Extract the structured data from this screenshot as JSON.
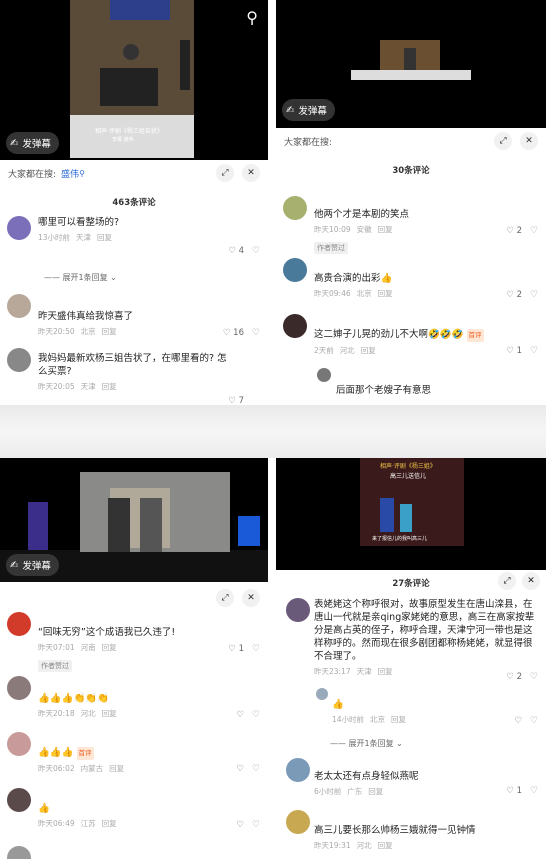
{
  "p1": {
    "danmu": "发弹幕",
    "search_label": "大家都在搜:",
    "search_kw": "盛伟",
    "count": "463条评论",
    "video_caption": "相声·评剧《杨三姐告状》",
    "video_caption2": "李菁 盛伟",
    "comments": [
      {
        "text": "哪里可以看整场的?",
        "time": "13小时前",
        "loc": "天津",
        "reply": "回复",
        "likes": "4",
        "expand": "展开1条回复"
      },
      {
        "text": "昨天盛伟真给我惊喜了",
        "time": "昨天20:50",
        "loc": "北京",
        "reply": "回复",
        "likes": "16"
      },
      {
        "text": "我妈妈最新欢杨三姐告状了，在哪里看的? 怎么买票?",
        "time": "昨天20:05",
        "loc": "天津",
        "reply": "回复",
        "likes": "7"
      }
    ]
  },
  "p2": {
    "danmu": "发弹幕",
    "search_label": "大家都在搜:",
    "count": "30条评论",
    "comments": [
      {
        "text": "他两个才是本剧的笑点",
        "time": "昨天10:09",
        "loc": "安徽",
        "reply": "回复",
        "likes": "2",
        "tag": "作者赞过"
      },
      {
        "text": "高贵合演的出彩👍",
        "time": "昨天09:46",
        "loc": "北京",
        "reply": "回复",
        "likes": "2"
      },
      {
        "text": "这二婶子儿晃的劲儿不大啊🤣🤣🤣",
        "time": "2天前",
        "loc": "河北",
        "reply": "回复",
        "likes": "1",
        "badge": "首评"
      },
      {
        "text": "后面那个老嫂子有意思"
      }
    ]
  },
  "p3": {
    "danmu": "发弹幕",
    "count": "",
    "comments": [
      {
        "text": "“回味无穷”这个成语我已久违了!",
        "time": "昨天07:01",
        "loc": "河南",
        "reply": "回复",
        "likes": "1",
        "tag": "作者赞过"
      },
      {
        "text": "👍👍👍👏👏👏",
        "time": "昨天20:18",
        "loc": "河北",
        "reply": "回复"
      },
      {
        "text": "👍👍👍",
        "time": "昨天06:02",
        "loc": "内蒙古",
        "reply": "回复",
        "badge": "首评"
      },
      {
        "text": "👍",
        "time": "昨天06:49",
        "loc": "江苏",
        "reply": "回复"
      }
    ]
  },
  "p4": {
    "count": "27条评论",
    "video_title": "相声·评剧《杨三姐》",
    "video_sub": "高三儿送信儿",
    "video_caption": "来了报信儿的我叫高三儿",
    "comments": [
      {
        "text": "表姥姥这个称呼很对，故事原型发生在唐山滦县，在唐山一代就是亲qing家姥姥的意思，高三在高家按辈分是高占英的侄子，称呼合理，天津宁河一带也是这样称呼的。然而现在很多剧团都称杨姥姥，就显得很不合理了。",
        "time": "昨天23:17",
        "loc": "天津",
        "reply": "回复",
        "likes": "2"
      },
      {
        "text": "👍",
        "time": "14小时前",
        "loc": "北京",
        "reply": "回复",
        "expand": "展开1条回复"
      },
      {
        "text": "老太太还有点身轻似燕呢",
        "time": "6小时前",
        "loc": "广东",
        "reply": "回复",
        "likes": "1"
      },
      {
        "text": "高三儿要长那么帅杨三娥就得一见钟情",
        "time": "昨天19:31",
        "loc": "河北",
        "reply": "回复"
      }
    ]
  },
  "colors": {
    "link": "#2a6ad8",
    "gap": "#ececec",
    "stage": "#6a5030"
  }
}
